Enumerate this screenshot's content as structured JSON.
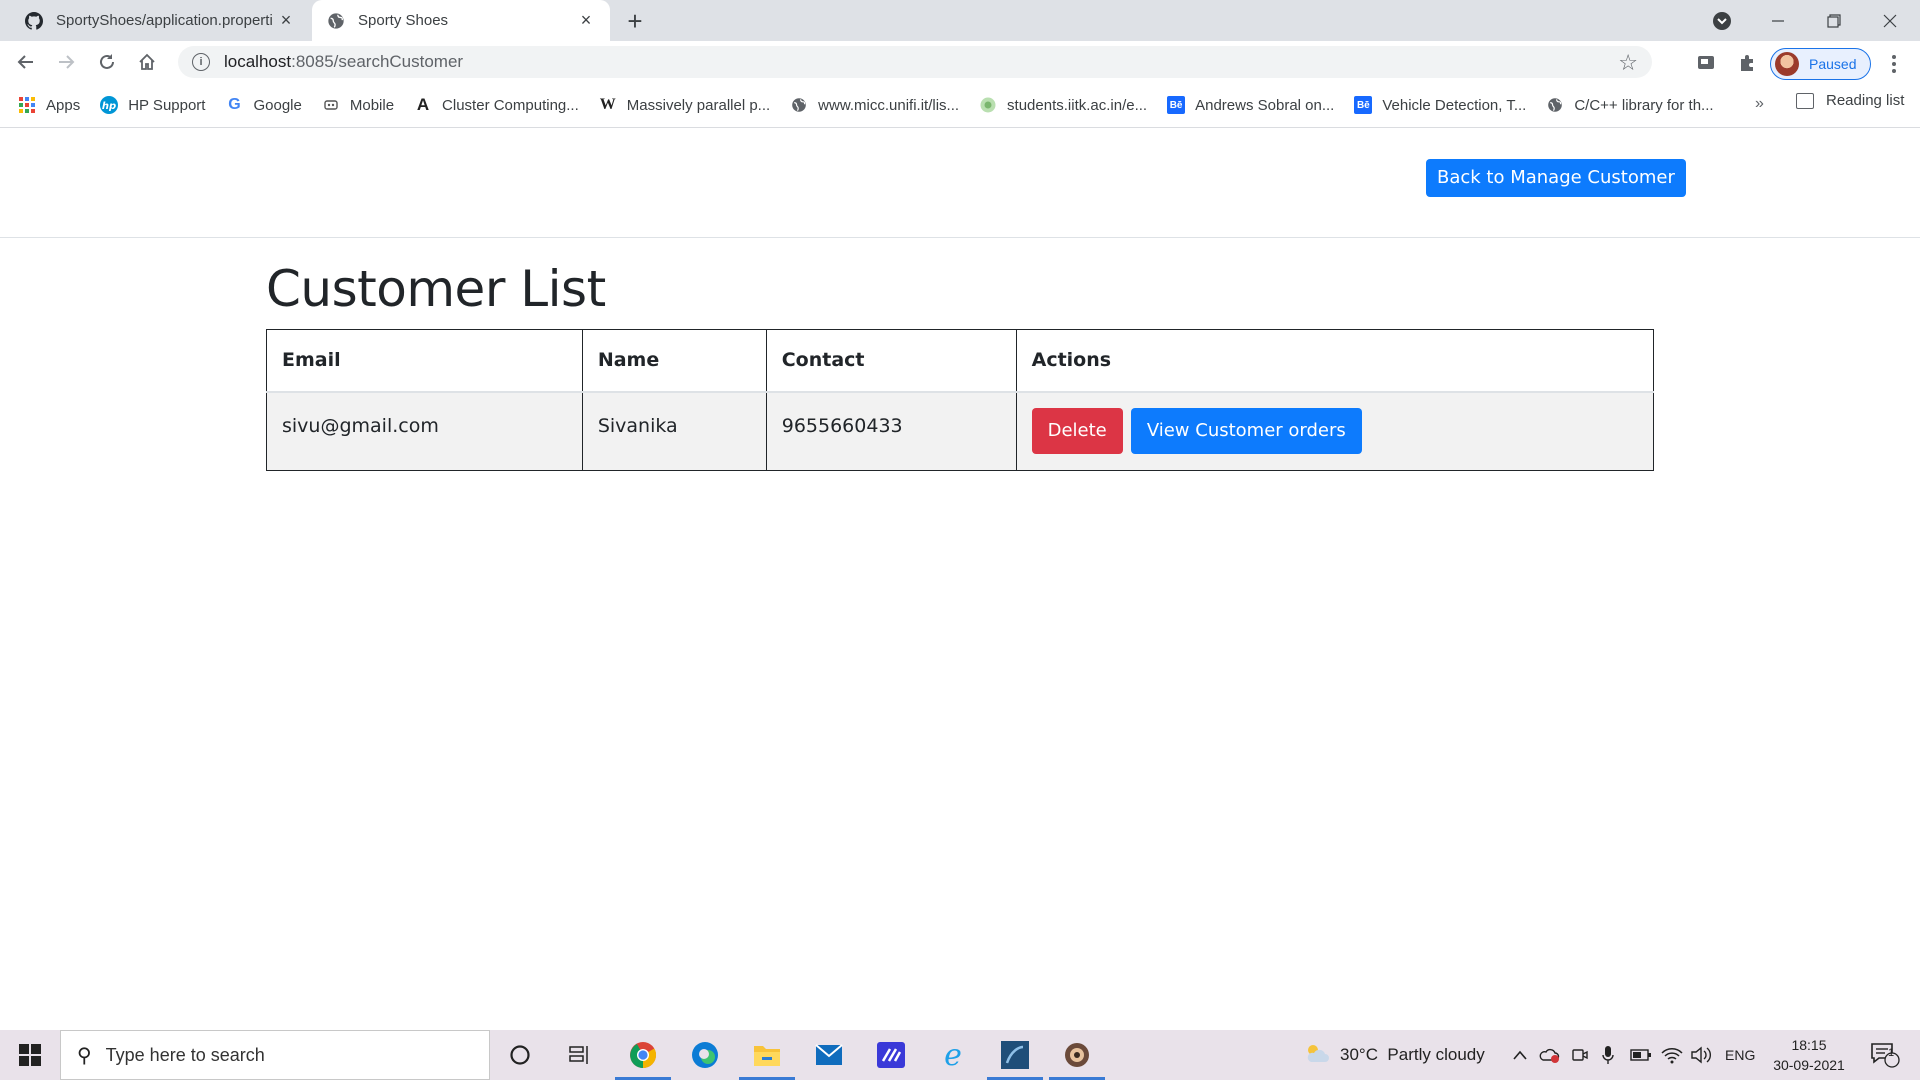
{
  "browser": {
    "tabs": [
      {
        "title": "SportyShoes/application.properti",
        "icon": "github-icon",
        "active": false
      },
      {
        "title": "Sporty Shoes",
        "icon": "globe-icon",
        "active": true
      }
    ],
    "url_host": "localhost",
    "url_path": ":8085/searchCustomer",
    "profile_label": "Paused",
    "bookmarks": [
      {
        "label": "Apps",
        "icon": "apps-grid-icon"
      },
      {
        "label": "HP Support",
        "icon": "hp-icon"
      },
      {
        "label": "Google",
        "icon": "google-icon"
      },
      {
        "label": "Mobile",
        "icon": "mobile-icon"
      },
      {
        "label": "Cluster Computing...",
        "icon": "a-letter-icon"
      },
      {
        "label": "Massively parallel p...",
        "icon": "wikipedia-icon"
      },
      {
        "label": "www.micc.unifi.it/lis...",
        "icon": "globe-icon"
      },
      {
        "label": "students.iitk.ac.in/e...",
        "icon": "iitk-icon"
      },
      {
        "label": "Andrews Sobral on...",
        "icon": "behance-icon"
      },
      {
        "label": "Vehicle Detection, T...",
        "icon": "behance-icon"
      },
      {
        "label": "C/C++ library for th...",
        "icon": "globe-icon"
      }
    ],
    "more_bookmarks": "»",
    "reading_list": "Reading list"
  },
  "page": {
    "back_button": "Back to Manage Customer",
    "title": "Customer List",
    "table": {
      "headers": [
        "Email",
        "Name",
        "Contact",
        "Actions"
      ],
      "rows": [
        {
          "email": "sivu@gmail.com",
          "name": "Sivanika",
          "contact": "9655660433",
          "delete_label": "Delete",
          "orders_label": "View Customer orders"
        }
      ]
    }
  },
  "colors": {
    "primary": "#0d7bfd",
    "danger": "#dc3545",
    "row_bg": "#f2f2f2"
  },
  "taskbar": {
    "search_placeholder": "Type here to search",
    "weather": "30°C  Partly cloudy",
    "language": "ENG",
    "time": "18:15",
    "date": "30-09-2021",
    "notifications": "1"
  }
}
